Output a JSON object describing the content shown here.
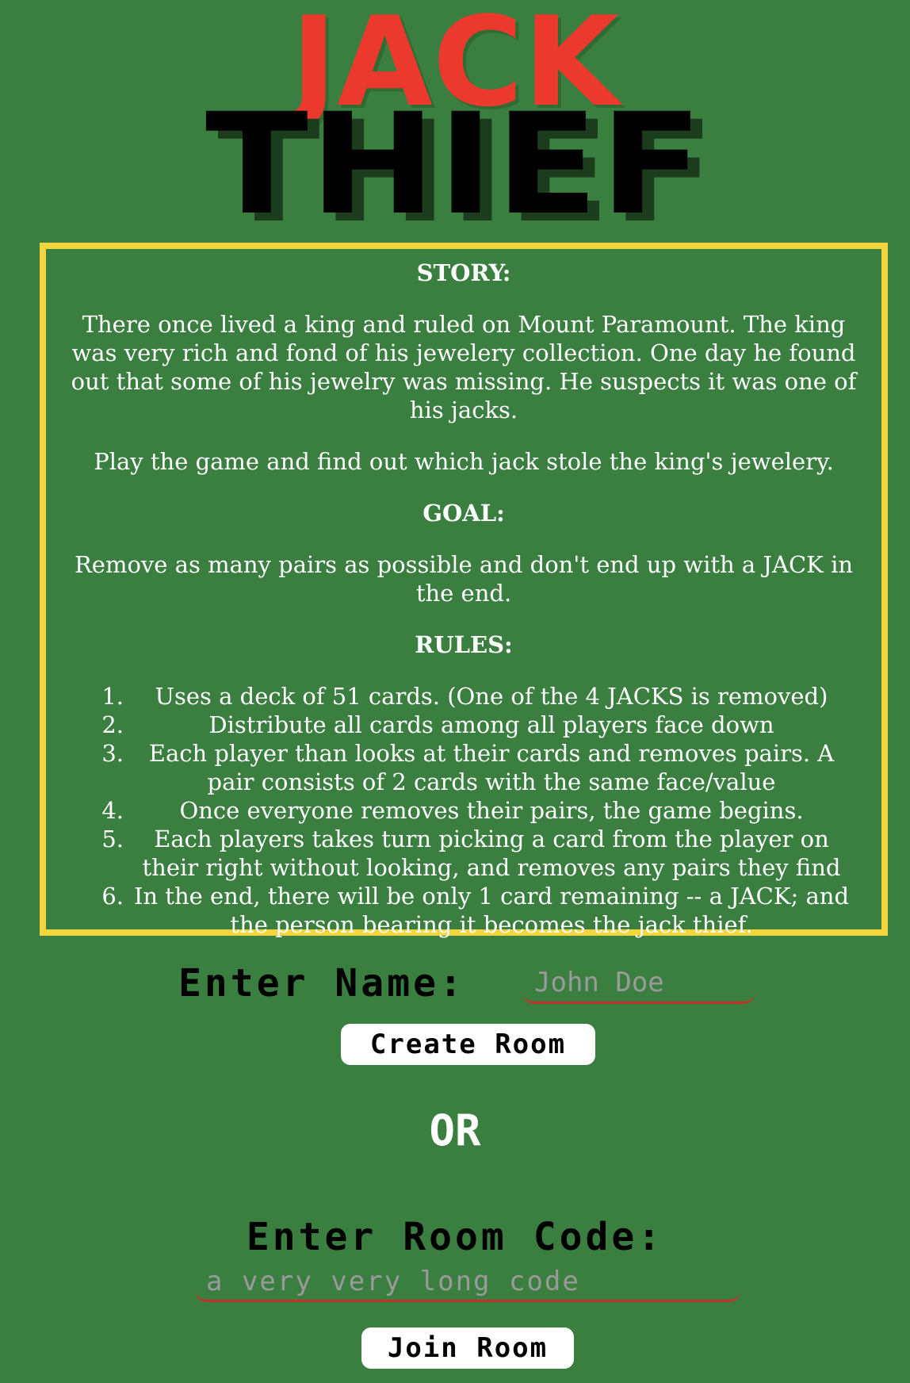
{
  "logo": {
    "line1": "JACK",
    "line2": "THIEF"
  },
  "info": {
    "story_heading": "STORY:",
    "story_p1": "There once lived a king and ruled on Mount Paramount. The king was very rich and fond of his jewelery collection. One day he found out that some of his jewelry was missing. He suspects it was one of his jacks.",
    "story_p2": "Play the game and find out which jack stole the king's jewelery.",
    "goal_heading": "GOAL:",
    "goal_text": "Remove as many pairs as possible and don't end up with a JACK in the end.",
    "rules_heading": "RULES:",
    "rules": [
      {
        "num": "1.",
        "text": "Uses a deck of 51 cards. (One of the 4 JACKS is removed)"
      },
      {
        "num": "2.",
        "text": "Distribute all cards among all players face down"
      },
      {
        "num": "3.",
        "text": "Each player than looks at their cards and removes pairs. A pair consists of 2 cards with the same face/value"
      },
      {
        "num": "4.",
        "text": "Once everyone removes their pairs, the game begins."
      },
      {
        "num": "5.",
        "text": "Each players takes turn picking a card from the player on their right without looking, and removes any pairs they find"
      },
      {
        "num": "6.",
        "text": "In the end, there will be only 1 card remaining -- a JACK; and the person bearing it becomes the jack thief."
      }
    ]
  },
  "form": {
    "name_label": "Enter Name:",
    "name_placeholder": "John Doe",
    "create_label": "Create Room",
    "or_label": "OR",
    "code_label": "Enter Room Code:",
    "code_placeholder": "a very very long code",
    "join_label": "Join Room"
  },
  "colors": {
    "background": "#3a7f40",
    "accent_red": "#ec392e",
    "border_yellow": "#f4d43c",
    "input_underline": "#c9302c"
  }
}
